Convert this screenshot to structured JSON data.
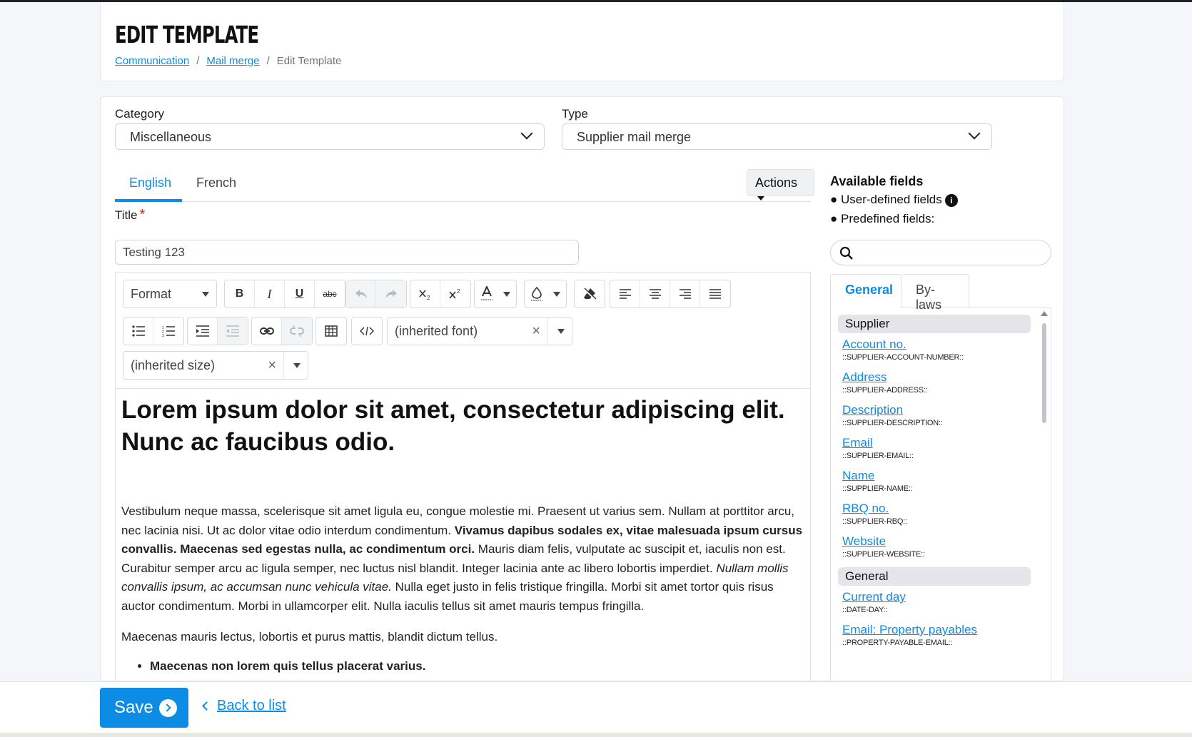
{
  "header": {
    "title": "EDIT TEMPLATE",
    "breadcrumb": [
      "Communication",
      "Mail merge",
      "Edit Template"
    ]
  },
  "form": {
    "category_label": "Category",
    "category_value": "Miscellaneous",
    "type_label": "Type",
    "type_value": "Supplier mail merge",
    "tabs": [
      "English",
      "French"
    ],
    "active_tab": "English",
    "actions_label": "Actions",
    "title_label": "Title",
    "title_required": "*",
    "title_value": "Testing 123"
  },
  "toolbar": {
    "format_label": "Format",
    "font_placeholder": "(inherited font)",
    "size_placeholder": "(inherited size)",
    "clear_glyph": "×",
    "bold_label": "B",
    "italic_label": "I",
    "underline_label": "U",
    "strike_label": "abc"
  },
  "content": {
    "heading": "Lorem ipsum dolor sit amet, consectetur adipiscing elit. Nunc ac faucibus odio.",
    "p1_a": "Vestibulum neque massa, scelerisque sit amet ligula eu, congue molestie mi. Praesent ut varius sem. Nullam at porttitor arcu, nec lacinia nisi. Ut ac dolor vitae odio interdum condimentum. ",
    "p1_bold": "Vivamus dapibus sodales ex, vitae malesuada ipsum cursus convallis. Maecenas sed egestas nulla, ac condimentum orci.",
    "p1_b": " Mauris diam felis, vulputate ac suscipit et, iaculis non est. Curabitur semper arcu ac ligula semper, nec luctus nisl blandit. Integer lacinia ante ac libero lobortis imperdiet. ",
    "p1_italic": "Nullam mollis convallis ipsum, ac accumsan nunc vehicula vitae.",
    "p1_c": " Nulla eget justo in felis tristique fringilla. Morbi sit amet tortor quis risus auctor condimentum. Morbi in ullamcorper elit. Nulla iaculis tellus sit amet mauris tempus fringilla.",
    "p2": "Maecenas mauris lectus, lobortis et purus mattis, blandit dictum tellus.",
    "bullet1": "Maecenas non lorem quis tellus placerat varius."
  },
  "panel": {
    "title": "Available fields",
    "user_defined": "● User-defined fields",
    "info_glyph": "i",
    "predefined": "● Predefined fields:",
    "tabs": [
      "General",
      "By-laws"
    ],
    "groups": [
      {
        "name": "Supplier",
        "items": [
          {
            "label": "Account no.",
            "code": "::SUPPLIER-ACCOUNT-NUMBER::"
          },
          {
            "label": "Address",
            "code": "::SUPPLIER-ADDRESS::"
          },
          {
            "label": "Description",
            "code": "::SUPPLIER-DESCRIPTION::"
          },
          {
            "label": "Email",
            "code": "::SUPPLIER-EMAIL::"
          },
          {
            "label": "Name",
            "code": "::SUPPLIER-NAME::"
          },
          {
            "label": "RBQ no.",
            "code": "::SUPPLIER-RBQ::"
          },
          {
            "label": "Website",
            "code": "::SUPPLIER-WEBSITE::"
          }
        ]
      },
      {
        "name": "General",
        "items": [
          {
            "label": "Current day",
            "code": "::DATE-DAY::"
          },
          {
            "label": "Email: Property payables",
            "code": "::PROPERTY-PAYABLE-EMAIL::"
          }
        ]
      }
    ]
  },
  "footer": {
    "save_label": "Save",
    "back_label": "Back to list"
  },
  "colors": {
    "accent": "#0d8ce5",
    "required": "#e02424"
  }
}
